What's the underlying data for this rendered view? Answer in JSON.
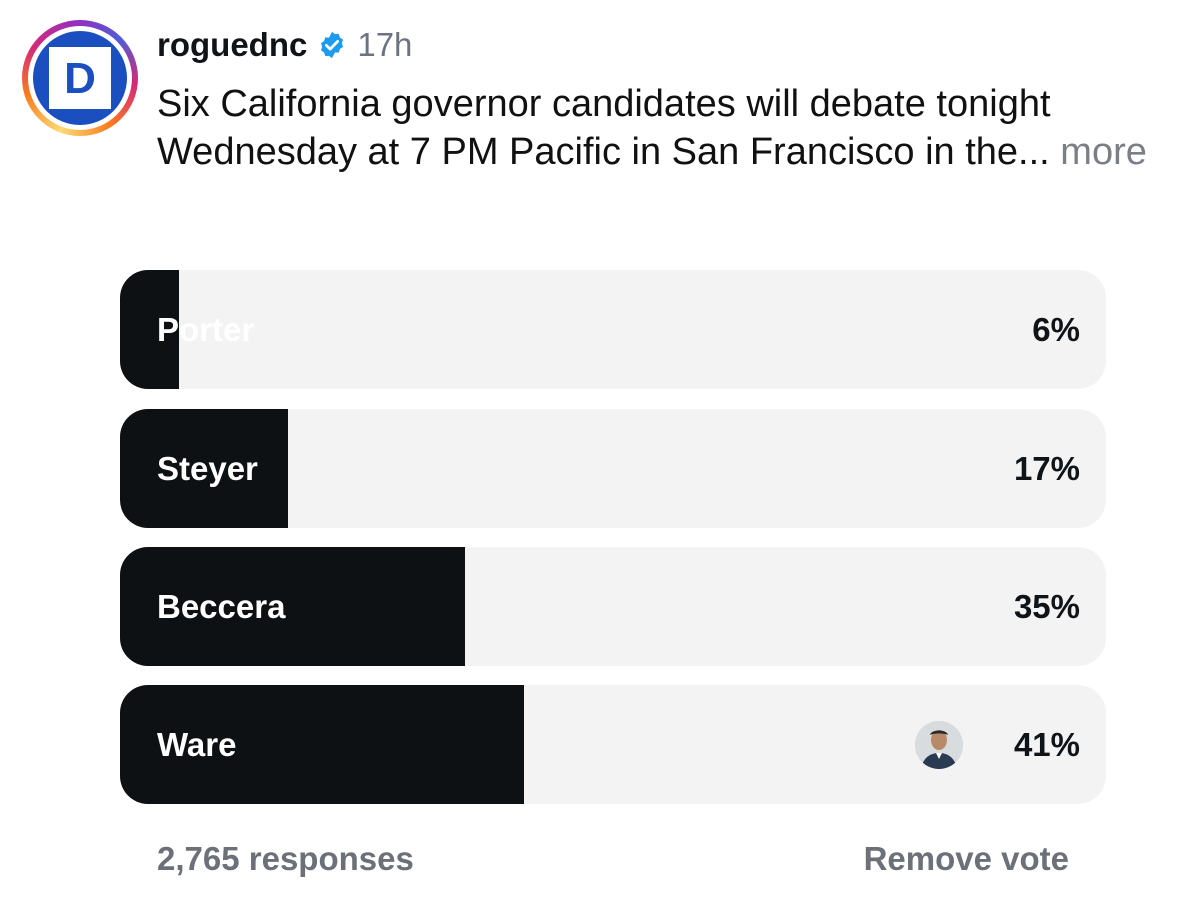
{
  "post": {
    "username": "roguednc",
    "time": "17h",
    "caption": "Six California governor candidates will debate tonight Wednesday at 7 PM Pacific in San Francisco in the...",
    "more_label": "more",
    "avatar_letter": "D"
  },
  "poll": {
    "options": [
      {
        "label": "Porter",
        "percent_text": "6%",
        "percent": 6
      },
      {
        "label": "Steyer",
        "percent_text": "17%",
        "percent": 17
      },
      {
        "label": "Beccera",
        "percent_text": "35%",
        "percent": 35
      },
      {
        "label": "Ware",
        "percent_text": "41%",
        "percent": 41
      }
    ],
    "responses": "2,765 responses",
    "remove_vote": "Remove vote"
  },
  "colors": {
    "fill": "#0e1114",
    "track": "#f3f3f3",
    "verified": "#1d9bf0",
    "muted": "#6b7079"
  },
  "icons": [
    "democratic-d-logo-icon",
    "verified-badge-icon",
    "voter-avatar-icon"
  ]
}
